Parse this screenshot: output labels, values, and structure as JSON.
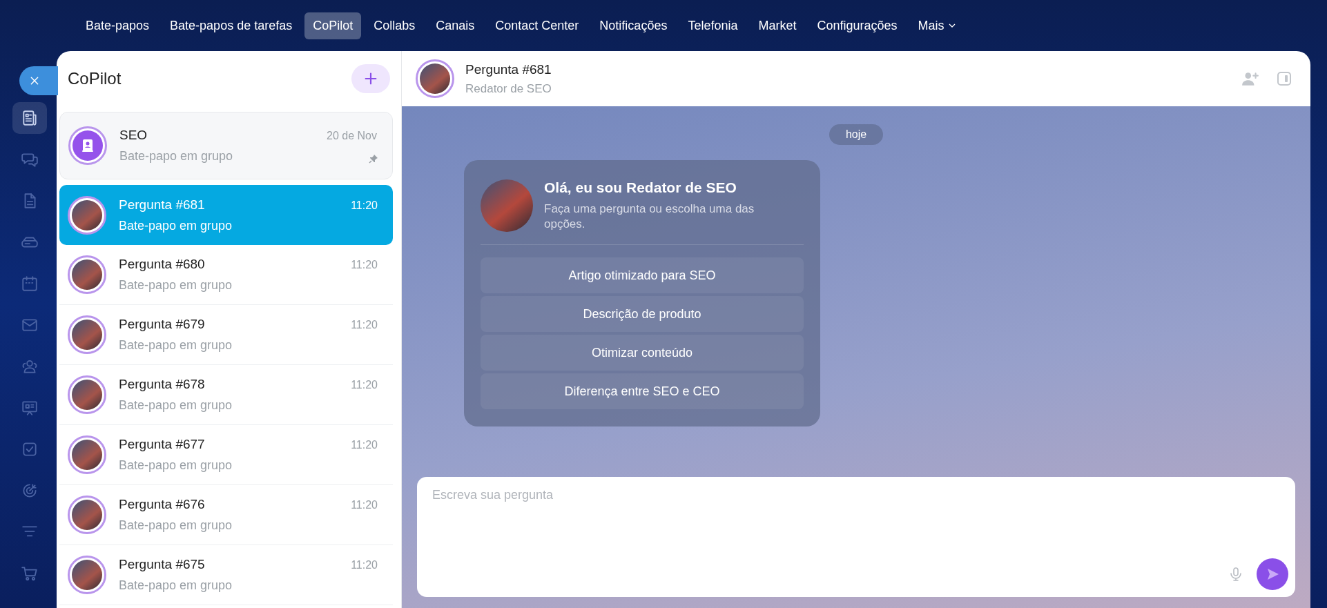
{
  "nav": {
    "items": [
      {
        "label": "Bate-papos",
        "selected": false
      },
      {
        "label": "Bate-papos de tarefas",
        "selected": false
      },
      {
        "label": "CoPilot",
        "selected": true
      },
      {
        "label": "Collabs",
        "selected": false
      },
      {
        "label": "Canais",
        "selected": false
      },
      {
        "label": "Contact Center",
        "selected": false
      },
      {
        "label": "Notificações",
        "selected": false
      },
      {
        "label": "Telefonia",
        "selected": false
      },
      {
        "label": "Market",
        "selected": false
      },
      {
        "label": "Configurações",
        "selected": false
      },
      {
        "label": "Mais",
        "selected": false,
        "dropdown": true
      }
    ]
  },
  "sidebar": {
    "items": [
      {
        "kind": "feed",
        "selected": true
      },
      {
        "kind": "chats",
        "selected": false
      },
      {
        "kind": "document",
        "selected": false
      },
      {
        "kind": "drive",
        "selected": false
      },
      {
        "kind": "calendar",
        "selected": false
      },
      {
        "kind": "mail",
        "selected": false
      },
      {
        "kind": "contacts",
        "selected": false
      },
      {
        "kind": "board",
        "selected": false
      },
      {
        "kind": "tasks",
        "selected": false
      },
      {
        "kind": "target",
        "selected": false
      },
      {
        "kind": "filter",
        "selected": false
      },
      {
        "kind": "cart",
        "selected": false
      }
    ]
  },
  "chat_list": {
    "title": "CoPilot",
    "items": [
      {
        "name": "SEO",
        "subtitle": "Bate-papo em grupo",
        "time": "20 de Nov",
        "kind": "icon",
        "pinned": true,
        "selected": false
      },
      {
        "name": "Pergunta #681",
        "subtitle": "Bate-papo em grupo",
        "time": "11:20",
        "kind": "photo",
        "pinned": false,
        "selected": true
      },
      {
        "name": "Pergunta #680",
        "subtitle": "Bate-papo em grupo",
        "time": "11:20",
        "kind": "photo",
        "pinned": false,
        "selected": false
      },
      {
        "name": "Pergunta #679",
        "subtitle": "Bate-papo em grupo",
        "time": "11:20",
        "kind": "photo",
        "pinned": false,
        "selected": false
      },
      {
        "name": "Pergunta #678",
        "subtitle": "Bate-papo em grupo",
        "time": "11:20",
        "kind": "photo",
        "pinned": false,
        "selected": false
      },
      {
        "name": "Pergunta #677",
        "subtitle": "Bate-papo em grupo",
        "time": "11:20",
        "kind": "photo",
        "pinned": false,
        "selected": false
      },
      {
        "name": "Pergunta #676",
        "subtitle": "Bate-papo em grupo",
        "time": "11:20",
        "kind": "photo",
        "pinned": false,
        "selected": false
      },
      {
        "name": "Pergunta #675",
        "subtitle": "Bate-papo em grupo",
        "time": "11:20",
        "kind": "photo",
        "pinned": false,
        "selected": false
      }
    ]
  },
  "chat": {
    "title": "Pergunta #681",
    "subtitle": "Redator de SEO",
    "date_divider": "hoje",
    "welcome": {
      "title": "Olá, eu sou Redator de SEO",
      "text": "Faça uma pergunta ou escolha uma das opções.",
      "options": [
        "Artigo otimizado para SEO",
        "Descrição de produto",
        "Otimizar conteúdo",
        "Diferença entre SEO e CEO"
      ]
    },
    "input": {
      "placeholder": "Escreva sua pergunta"
    }
  }
}
